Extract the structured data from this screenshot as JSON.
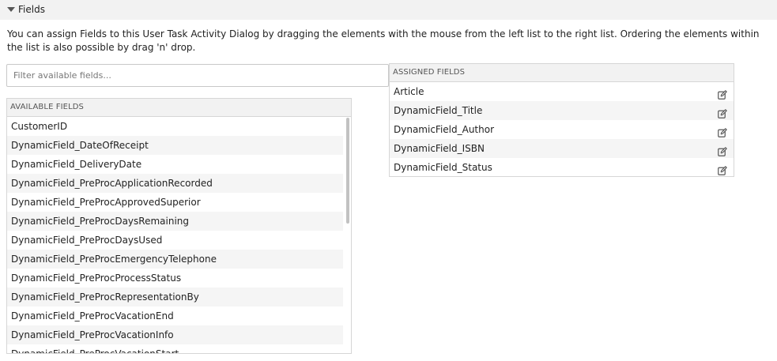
{
  "section": {
    "title": "Fields"
  },
  "description": "You can assign Fields to this User Task Activity Dialog by dragging the elements with the mouse from the left list to the right list. Ordering the elements within the list is also possible by drag 'n' drop.",
  "filter": {
    "placeholder": "Filter available fields...",
    "value": ""
  },
  "available": {
    "header": "Available Fields",
    "items": [
      "CustomerID",
      "DynamicField_DateOfReceipt",
      "DynamicField_DeliveryDate",
      "DynamicField_PreProcApplicationRecorded",
      "DynamicField_PreProcApprovedSuperior",
      "DynamicField_PreProcDaysRemaining",
      "DynamicField_PreProcDaysUsed",
      "DynamicField_PreProcEmergencyTelephone",
      "DynamicField_PreProcProcessStatus",
      "DynamicField_PreProcRepresentationBy",
      "DynamicField_PreProcVacationEnd",
      "DynamicField_PreProcVacationInfo",
      "DynamicField_PreProcVacationStart"
    ]
  },
  "assigned": {
    "header": "Assigned Fields",
    "items": [
      "Article",
      "DynamicField_Title",
      "DynamicField_Author",
      "DynamicField_ISBN",
      "DynamicField_Status"
    ]
  },
  "icons": {
    "toggle": "chevron-down-icon",
    "edit": "edit-icon"
  },
  "colors": {
    "header_bg": "#f2f2f2",
    "border": "#d6d6d6",
    "row_alt": "#f5f5f5",
    "icon": "#555555"
  }
}
